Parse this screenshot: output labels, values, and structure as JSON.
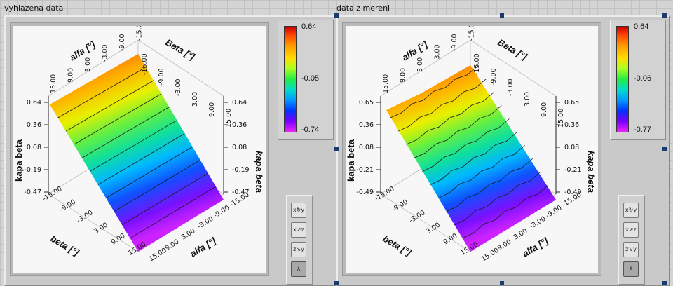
{
  "graphs": [
    {
      "caption": "vyhlazena data",
      "colorbar": {
        "max": "0.64",
        "mid": "-0.05",
        "min": "-0.74"
      },
      "axes": {
        "alfa_title": "alfa",
        "beta_title": "Beta",
        "unit": "[°]",
        "beta_front_title": "beta",
        "alfa_front_title": "alfa",
        "kapa_left": "kapa beta",
        "kapa_right": "kapa beta",
        "z_ticks": [
          "0.64",
          "0.36",
          "0.08",
          "-0.19",
          "-0.47"
        ],
        "ab_ticks": [
          "15.00",
          "9.00",
          "3.00",
          "-3.00",
          "-9.00",
          "-15.00"
        ],
        "front_ticks": [
          "-15.00",
          "-9.00",
          "-3.00",
          "3.00",
          "9.00",
          "15.00"
        ]
      }
    },
    {
      "caption": "data z mereni",
      "colorbar": {
        "max": "0.64",
        "mid": "-0.06",
        "min": "-0.77"
      },
      "axes": {
        "alfa_title": "alfa",
        "beta_title": "Beta",
        "unit": "[°]",
        "beta_front_title": "beta",
        "alfa_front_title": "alfa",
        "kapa_left": "kapa beta",
        "kapa_right": "kapa beta",
        "z_ticks": [
          "0.65",
          "0.36",
          "0.08",
          "-0.21",
          "-0.49"
        ],
        "ab_ticks": [
          "15.00",
          "9.00",
          "3.00",
          "-3.00",
          "-9.00",
          "-15.00"
        ],
        "front_ticks": [
          "-15.00",
          "-9.00",
          "-3.00",
          "3.00",
          "9.00",
          "15.00"
        ]
      }
    }
  ],
  "tools": [
    {
      "name": "rotate-xy-tool",
      "glyph": "x↻y"
    },
    {
      "name": "rotate-xz-tool",
      "glyph": "x↗z"
    },
    {
      "name": "rotate-zy-tool",
      "glyph": "z↘y"
    },
    {
      "name": "reset-view-tool",
      "glyph": "⅄"
    }
  ],
  "colors": {
    "panel": "#c9c9c9",
    "surface_top": "#ee2200",
    "surface_bottom": "#cc22ff"
  }
}
